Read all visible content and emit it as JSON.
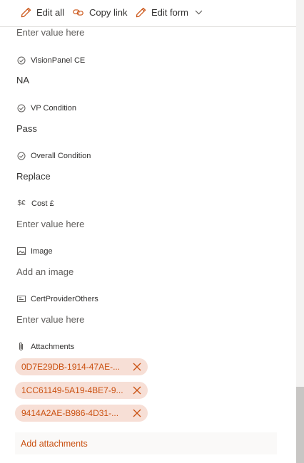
{
  "toolbar": {
    "edit_all": "Edit all",
    "copy_link": "Copy link",
    "edit_form": "Edit form"
  },
  "fields": {
    "top_value": "Enter value here",
    "vision_panel": {
      "label": "VisionPanel CE",
      "value": "NA"
    },
    "vp_condition": {
      "label": "VP Condition",
      "value": "Pass"
    },
    "overall_condition": {
      "label": "Overall Condition",
      "value": "Replace"
    },
    "cost": {
      "label": "Cost £",
      "value": "Enter value here"
    },
    "image": {
      "label": "Image",
      "value": "Add an image"
    },
    "cert_provider": {
      "label": "CertProviderOthers",
      "value": "Enter value here"
    },
    "attachments": {
      "label": "Attachments",
      "items": [
        "0D7E29DB-1914-47AE-...",
        "1CC61149-5A19-4BE7-9...",
        "9414A2AE-B986-4D31-..."
      ],
      "add_label": "Add attachments"
    }
  },
  "colors": {
    "accent": "#ca5010",
    "chip_bg": "#f7dfd6",
    "text": "#323130",
    "muted": "#605e5c"
  }
}
